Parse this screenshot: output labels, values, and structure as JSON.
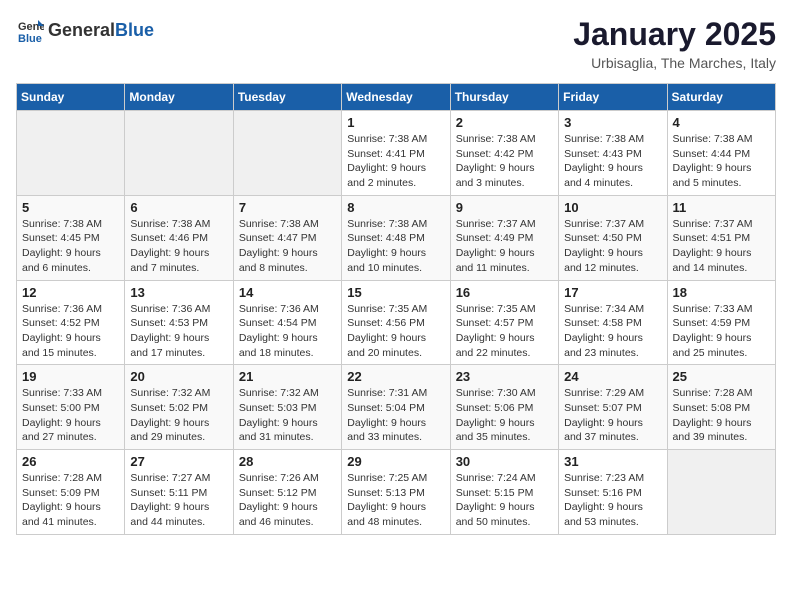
{
  "header": {
    "logo_general": "General",
    "logo_blue": "Blue",
    "title": "January 2025",
    "subtitle": "Urbisaglia, The Marches, Italy"
  },
  "weekdays": [
    "Sunday",
    "Monday",
    "Tuesday",
    "Wednesday",
    "Thursday",
    "Friday",
    "Saturday"
  ],
  "weeks": [
    [
      {
        "day": "",
        "sunrise": "",
        "sunset": "",
        "daylight": ""
      },
      {
        "day": "",
        "sunrise": "",
        "sunset": "",
        "daylight": ""
      },
      {
        "day": "",
        "sunrise": "",
        "sunset": "",
        "daylight": ""
      },
      {
        "day": "1",
        "sunrise": "Sunrise: 7:38 AM",
        "sunset": "Sunset: 4:41 PM",
        "daylight": "Daylight: 9 hours and 2 minutes."
      },
      {
        "day": "2",
        "sunrise": "Sunrise: 7:38 AM",
        "sunset": "Sunset: 4:42 PM",
        "daylight": "Daylight: 9 hours and 3 minutes."
      },
      {
        "day": "3",
        "sunrise": "Sunrise: 7:38 AM",
        "sunset": "Sunset: 4:43 PM",
        "daylight": "Daylight: 9 hours and 4 minutes."
      },
      {
        "day": "4",
        "sunrise": "Sunrise: 7:38 AM",
        "sunset": "Sunset: 4:44 PM",
        "daylight": "Daylight: 9 hours and 5 minutes."
      }
    ],
    [
      {
        "day": "5",
        "sunrise": "Sunrise: 7:38 AM",
        "sunset": "Sunset: 4:45 PM",
        "daylight": "Daylight: 9 hours and 6 minutes."
      },
      {
        "day": "6",
        "sunrise": "Sunrise: 7:38 AM",
        "sunset": "Sunset: 4:46 PM",
        "daylight": "Daylight: 9 hours and 7 minutes."
      },
      {
        "day": "7",
        "sunrise": "Sunrise: 7:38 AM",
        "sunset": "Sunset: 4:47 PM",
        "daylight": "Daylight: 9 hours and 8 minutes."
      },
      {
        "day": "8",
        "sunrise": "Sunrise: 7:38 AM",
        "sunset": "Sunset: 4:48 PM",
        "daylight": "Daylight: 9 hours and 10 minutes."
      },
      {
        "day": "9",
        "sunrise": "Sunrise: 7:37 AM",
        "sunset": "Sunset: 4:49 PM",
        "daylight": "Daylight: 9 hours and 11 minutes."
      },
      {
        "day": "10",
        "sunrise": "Sunrise: 7:37 AM",
        "sunset": "Sunset: 4:50 PM",
        "daylight": "Daylight: 9 hours and 12 minutes."
      },
      {
        "day": "11",
        "sunrise": "Sunrise: 7:37 AM",
        "sunset": "Sunset: 4:51 PM",
        "daylight": "Daylight: 9 hours and 14 minutes."
      }
    ],
    [
      {
        "day": "12",
        "sunrise": "Sunrise: 7:36 AM",
        "sunset": "Sunset: 4:52 PM",
        "daylight": "Daylight: 9 hours and 15 minutes."
      },
      {
        "day": "13",
        "sunrise": "Sunrise: 7:36 AM",
        "sunset": "Sunset: 4:53 PM",
        "daylight": "Daylight: 9 hours and 17 minutes."
      },
      {
        "day": "14",
        "sunrise": "Sunrise: 7:36 AM",
        "sunset": "Sunset: 4:54 PM",
        "daylight": "Daylight: 9 hours and 18 minutes."
      },
      {
        "day": "15",
        "sunrise": "Sunrise: 7:35 AM",
        "sunset": "Sunset: 4:56 PM",
        "daylight": "Daylight: 9 hours and 20 minutes."
      },
      {
        "day": "16",
        "sunrise": "Sunrise: 7:35 AM",
        "sunset": "Sunset: 4:57 PM",
        "daylight": "Daylight: 9 hours and 22 minutes."
      },
      {
        "day": "17",
        "sunrise": "Sunrise: 7:34 AM",
        "sunset": "Sunset: 4:58 PM",
        "daylight": "Daylight: 9 hours and 23 minutes."
      },
      {
        "day": "18",
        "sunrise": "Sunrise: 7:33 AM",
        "sunset": "Sunset: 4:59 PM",
        "daylight": "Daylight: 9 hours and 25 minutes."
      }
    ],
    [
      {
        "day": "19",
        "sunrise": "Sunrise: 7:33 AM",
        "sunset": "Sunset: 5:00 PM",
        "daylight": "Daylight: 9 hours and 27 minutes."
      },
      {
        "day": "20",
        "sunrise": "Sunrise: 7:32 AM",
        "sunset": "Sunset: 5:02 PM",
        "daylight": "Daylight: 9 hours and 29 minutes."
      },
      {
        "day": "21",
        "sunrise": "Sunrise: 7:32 AM",
        "sunset": "Sunset: 5:03 PM",
        "daylight": "Daylight: 9 hours and 31 minutes."
      },
      {
        "day": "22",
        "sunrise": "Sunrise: 7:31 AM",
        "sunset": "Sunset: 5:04 PM",
        "daylight": "Daylight: 9 hours and 33 minutes."
      },
      {
        "day": "23",
        "sunrise": "Sunrise: 7:30 AM",
        "sunset": "Sunset: 5:06 PM",
        "daylight": "Daylight: 9 hours and 35 minutes."
      },
      {
        "day": "24",
        "sunrise": "Sunrise: 7:29 AM",
        "sunset": "Sunset: 5:07 PM",
        "daylight": "Daylight: 9 hours and 37 minutes."
      },
      {
        "day": "25",
        "sunrise": "Sunrise: 7:28 AM",
        "sunset": "Sunset: 5:08 PM",
        "daylight": "Daylight: 9 hours and 39 minutes."
      }
    ],
    [
      {
        "day": "26",
        "sunrise": "Sunrise: 7:28 AM",
        "sunset": "Sunset: 5:09 PM",
        "daylight": "Daylight: 9 hours and 41 minutes."
      },
      {
        "day": "27",
        "sunrise": "Sunrise: 7:27 AM",
        "sunset": "Sunset: 5:11 PM",
        "daylight": "Daylight: 9 hours and 44 minutes."
      },
      {
        "day": "28",
        "sunrise": "Sunrise: 7:26 AM",
        "sunset": "Sunset: 5:12 PM",
        "daylight": "Daylight: 9 hours and 46 minutes."
      },
      {
        "day": "29",
        "sunrise": "Sunrise: 7:25 AM",
        "sunset": "Sunset: 5:13 PM",
        "daylight": "Daylight: 9 hours and 48 minutes."
      },
      {
        "day": "30",
        "sunrise": "Sunrise: 7:24 AM",
        "sunset": "Sunset: 5:15 PM",
        "daylight": "Daylight: 9 hours and 50 minutes."
      },
      {
        "day": "31",
        "sunrise": "Sunrise: 7:23 AM",
        "sunset": "Sunset: 5:16 PM",
        "daylight": "Daylight: 9 hours and 53 minutes."
      },
      {
        "day": "",
        "sunrise": "",
        "sunset": "",
        "daylight": ""
      }
    ]
  ]
}
